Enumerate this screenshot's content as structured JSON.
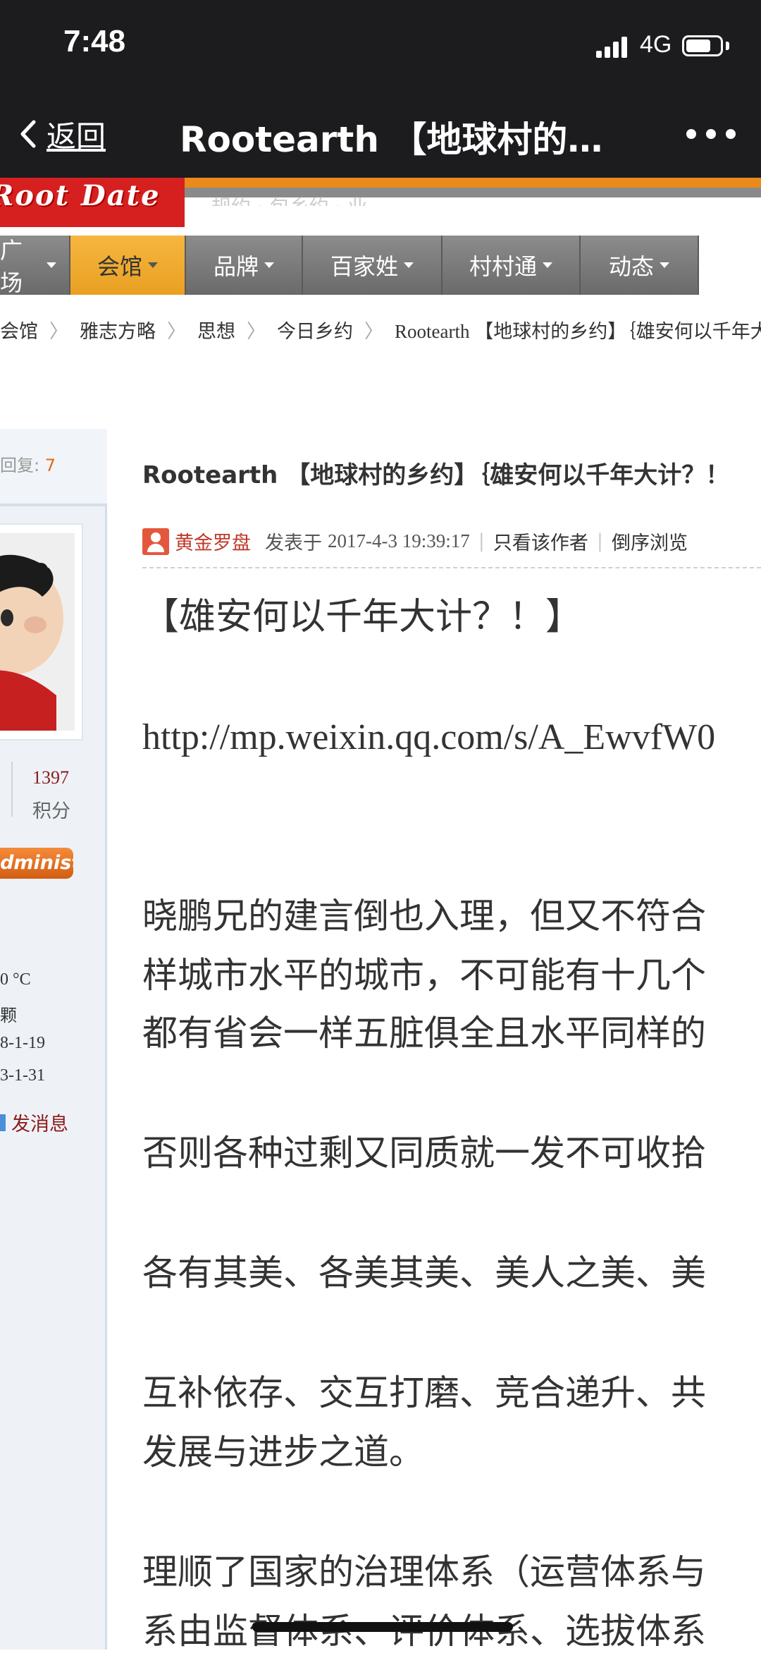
{
  "status_bar": {
    "time": "7:48",
    "network": "4G"
  },
  "nav": {
    "back_label": "返回",
    "title": "Rootearth 【地球村的乡…"
  },
  "site": {
    "logo_text": "Root Date",
    "slogan": "规约 · 包乡约 · 业"
  },
  "menu": [
    {
      "label": "广场",
      "active": false
    },
    {
      "label": "会馆",
      "active": true
    },
    {
      "label": "品牌",
      "active": false
    },
    {
      "label": "百家姓",
      "active": false
    },
    {
      "label": "村村通",
      "active": false
    },
    {
      "label": "动态",
      "active": false
    }
  ],
  "breadcrumb": [
    "会馆",
    "雅志方略",
    "思想",
    "今日乡约",
    "Rootearth 【地球村的乡约】｛雄安何以千年大"
  ],
  "sidebar": {
    "reply_label": "回复:",
    "reply_count": "7",
    "points_value": "1397",
    "points_label": "积分",
    "badge": "Administrator",
    "stats": [
      "0 °C",
      "颗",
      "8-1-19",
      "3-1-31"
    ],
    "message_link": "发消息"
  },
  "post": {
    "title": "Rootearth 【地球村的乡约】｛雄安何以千年大计？！",
    "author": "黄金罗盘",
    "posted_prefix": "发表于",
    "posted_time": "2017-4-3 19:39:17",
    "only_author": "只看该作者",
    "reverse_browse": "倒序浏览",
    "headline": "【雄安何以千年大计？！】",
    "url": "http://mp.weixin.qq.com/s/A_EwvfW0",
    "paragraphs": [
      "晓鹏兄的建言倒也入理，但又不符合",
      "样城市水平的城市，不可能有十几个",
      "都有省会一样五脏俱全且水平同样的",
      "否则各种过剩又同质就一发不可收拾",
      "各有其美、各美其美、美人之美、美",
      "互补依存、交互打磨、竞合递升、共",
      "发展与进步之道。",
      "理顺了国家的治理体系（运营体系与",
      "系由监督体系、评价体系、选拔体系"
    ]
  },
  "colors": {
    "menu_active": "#f0aa30",
    "menu_bg": "#7a7a7a",
    "logo_red": "#d62020",
    "accent_orange": "#e98a1a",
    "link_red": "#8b1a1a"
  }
}
